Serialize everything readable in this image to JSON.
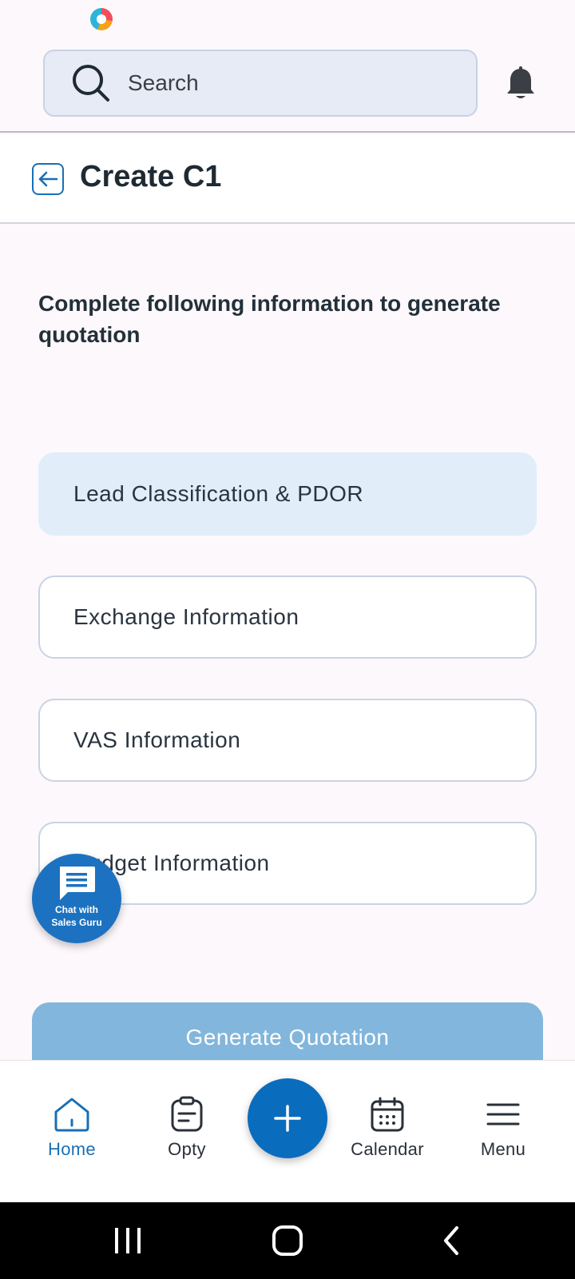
{
  "search": {
    "placeholder": "Search"
  },
  "page": {
    "title": "Create C1",
    "subtitle": "Complete following information to generate quotation"
  },
  "sections": [
    {
      "label": "Lead Classification & PDOR",
      "state": "active"
    },
    {
      "label": "Exchange Information",
      "state": "default"
    },
    {
      "label": "VAS Information",
      "state": "default"
    },
    {
      "label": "Budget Information",
      "state": "default"
    }
  ],
  "chat_fab": {
    "label": "Chat with Sales Guru",
    "icon": "chat-bubble-icon"
  },
  "generate_button": {
    "label": "Generate Quotation",
    "state": "disabled"
  },
  "bottom_nav": {
    "items": [
      {
        "label": "Home",
        "icon": "home-icon",
        "active": true
      },
      {
        "label": "Opty",
        "icon": "clipboard-icon",
        "active": false
      },
      {
        "label": "Calendar",
        "icon": "calendar-icon",
        "active": false
      },
      {
        "label": "Menu",
        "icon": "hamburger-icon",
        "active": false
      }
    ],
    "center_action_icon": "plus-icon"
  },
  "colors": {
    "primary": "#0a6cbd",
    "active_section_bg": "#e1eefa",
    "disabled_button": "#82b6dc",
    "page_bg": "#fdf8fb"
  }
}
